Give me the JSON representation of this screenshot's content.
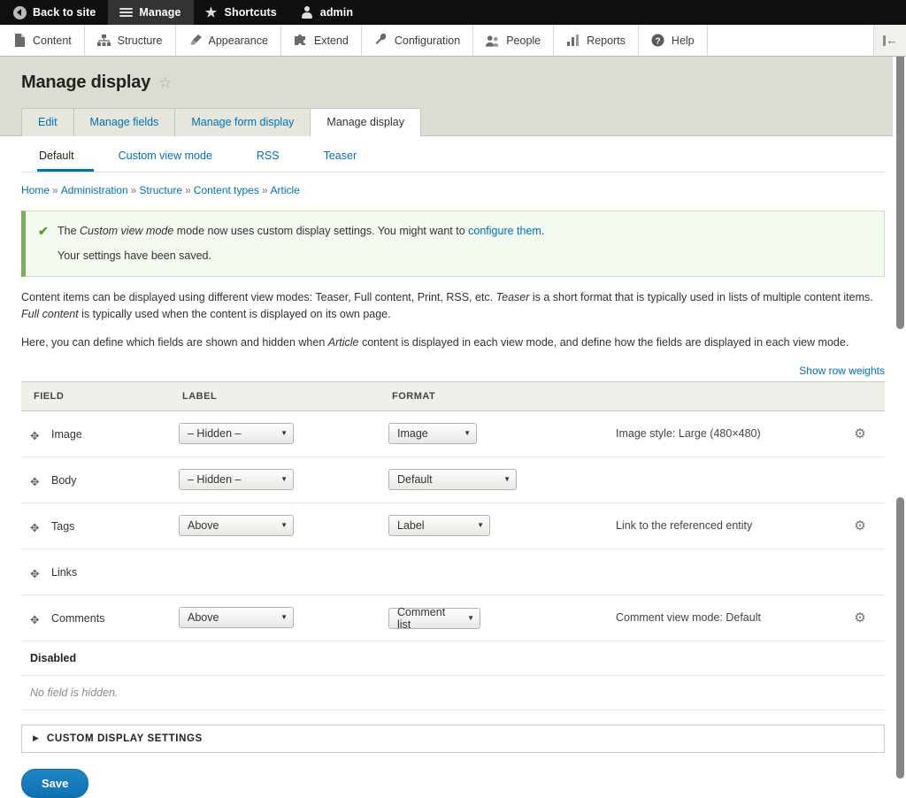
{
  "toolbar": {
    "items": [
      {
        "label": "Back to site",
        "icon": "back-arrow-icon",
        "active": false
      },
      {
        "label": "Manage",
        "icon": "hamburger-icon",
        "active": true
      },
      {
        "label": "Shortcuts",
        "icon": "star-icon",
        "active": false
      },
      {
        "label": "admin",
        "icon": "person-icon",
        "active": false
      }
    ]
  },
  "menubar": {
    "items": [
      {
        "label": "Content",
        "icon": "document-icon"
      },
      {
        "label": "Structure",
        "icon": "sitemap-icon"
      },
      {
        "label": "Appearance",
        "icon": "paintbrush-icon"
      },
      {
        "label": "Extend",
        "icon": "puzzle-icon"
      },
      {
        "label": "Configuration",
        "icon": "wrench-icon"
      },
      {
        "label": "People",
        "icon": "people-icon"
      },
      {
        "label": "Reports",
        "icon": "bar-chart-icon"
      },
      {
        "label": "Help",
        "icon": "question-mark-icon"
      }
    ],
    "orientation_toggle": "toolbar-orientation-icon"
  },
  "page": {
    "title": "Manage display",
    "star_icon": "star-outline-icon"
  },
  "primary_tabs": [
    {
      "label": "Edit",
      "active": false
    },
    {
      "label": "Manage fields",
      "active": false
    },
    {
      "label": "Manage form display",
      "active": false
    },
    {
      "label": "Manage display",
      "active": true
    }
  ],
  "secondary_tabs": [
    {
      "label": "Default",
      "active": true
    },
    {
      "label": "Custom view mode",
      "active": false
    },
    {
      "label": "RSS",
      "active": false
    },
    {
      "label": "Teaser",
      "active": false
    }
  ],
  "breadcrumb": [
    {
      "label": "Home"
    },
    {
      "label": "Administration"
    },
    {
      "label": "Structure"
    },
    {
      "label": "Content types"
    },
    {
      "label": "Article"
    }
  ],
  "breadcrumb_separator": "»",
  "status": {
    "check_icon": "✔",
    "line1_part1": "The ",
    "line1_em": "Custom view mode",
    "line1_part2": " mode now uses custom display settings. You might want to ",
    "line1_link": "configure them",
    "line1_part3": ".",
    "line2": "Your settings have been saved."
  },
  "help": {
    "p1_a": "Content items can be displayed using different view modes: Teaser, Full content, Print, RSS, etc. ",
    "p1_em1": "Teaser",
    "p1_b": " is a short format that is typically used in lists of multiple content items. ",
    "p1_em2": "Full content",
    "p1_c": " is typically used when the content is displayed on its own page.",
    "p2_a": "Here, you can define which fields are shown and hidden when ",
    "p2_em": "Article",
    "p2_b": " content is displayed in each view mode, and define how the fields are displayed in each view mode."
  },
  "show_row_weights": "Show row weights",
  "table": {
    "headers": [
      "FIELD",
      "LABEL",
      "FORMAT",
      "",
      ""
    ],
    "rows": [
      {
        "drag": "✥",
        "field": "Image",
        "label": "– Hidden –",
        "format": "Image",
        "summary": "Image style: Large (480×480)",
        "gear": true
      },
      {
        "drag": "✥",
        "field": "Body",
        "label": "– Hidden –",
        "format": "Default",
        "summary": "",
        "gear": false
      },
      {
        "drag": "✥",
        "field": "Tags",
        "label": "Above",
        "format": "Label",
        "summary": "Link to the referenced entity",
        "gear": true
      },
      {
        "drag": "✥",
        "field": "Links",
        "label": "",
        "format": "",
        "summary": "",
        "gear": false
      },
      {
        "drag": "✥",
        "field": "Comments",
        "label": "Above",
        "format": "Comment list",
        "summary": "Comment view mode: Default",
        "gear": true
      }
    ],
    "disabled_header": "Disabled",
    "disabled_empty": "No field is hidden."
  },
  "details": {
    "arrow": "▶",
    "title": "CUSTOM DISPLAY SETTINGS"
  },
  "save_button": "Save",
  "colors": {
    "accent_blue": "#0071b3",
    "toolbar_dark": "#0f0f0f",
    "page_band": "#dcdcd3",
    "status_green": "#77b259"
  }
}
